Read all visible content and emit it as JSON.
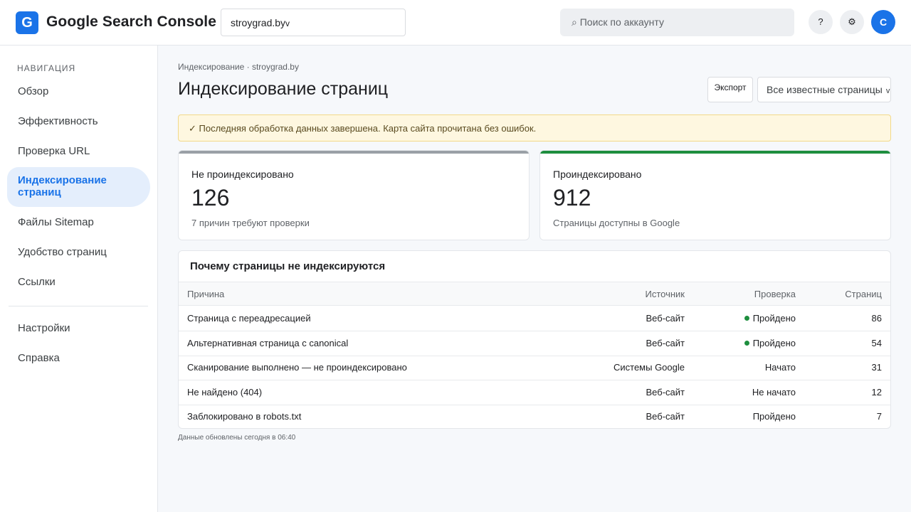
{
  "header": {
    "logo_letter": "G",
    "app_title": "Google Search Console",
    "property": "stroygrad.by",
    "property_chevron": "v",
    "search_placeholder": "⌕ Поиск по аккаунту",
    "help_label": "?",
    "settings_label": "⚙",
    "avatar_letter": "С"
  },
  "sidebar": {
    "section_label": "НАВИГАЦИЯ",
    "items": [
      {
        "label": "Обзор"
      },
      {
        "label": "Эффективность"
      },
      {
        "label": "Проверка URL"
      },
      {
        "label": "Индексирование страниц",
        "active": true
      },
      {
        "label": "Файлы Sitemap"
      },
      {
        "label": "Удобство страниц"
      },
      {
        "label": "Ссылки"
      }
    ],
    "secondary_items": [
      {
        "label": "Настройки"
      },
      {
        "label": "Справка"
      }
    ]
  },
  "main": {
    "breadcrumb": "Индексирование · stroygrad.by",
    "title": "Индексирование страниц",
    "export_label": "Экспорт",
    "filter_label": "Все известные страницы",
    "filter_chevron": "v",
    "banner": "✓ Последняя обработка данных завершена. Карта сайта прочитана без ошибок.",
    "cards": [
      {
        "label": "Не проиндексировано",
        "value": "126",
        "sub": "7 причин требуют проверки",
        "accent": "#9aa0a6"
      },
      {
        "label": "Проиндексировано",
        "value": "912",
        "sub": "Страницы доступны в Google",
        "accent": "#1e8e3e"
      }
    ],
    "table": {
      "title": "Почему страницы не индексируются",
      "columns": [
        "Причина",
        "Источник",
        "Проверка",
        "Страниц"
      ],
      "rows": [
        {
          "reason": "Страница с переадресацией",
          "source": "Веб-сайт",
          "check": "Пройдено",
          "dot": true,
          "count": "86"
        },
        {
          "reason": "Альтернативная страница с canonical",
          "source": "Веб-сайт",
          "check": "Пройдено",
          "dot": true,
          "count": "54"
        },
        {
          "reason": "Сканирование выполнено — не проиндексировано",
          "source": "Системы Google",
          "check": "Начато",
          "dot": false,
          "count": "31"
        },
        {
          "reason": "Не найдено (404)",
          "source": "Веб-сайт",
          "check": "Не начато",
          "dot": false,
          "count": "12"
        },
        {
          "reason": "Заблокировано в robots.txt",
          "source": "Веб-сайт",
          "check": "Пройдено",
          "dot": false,
          "count": "7"
        }
      ]
    },
    "footnote": "Данные обновлены сегодня в 06:40"
  },
  "colors": {
    "accent": "#1a73e8",
    "success": "#1e8e3e",
    "neutral_bar": "#9aa0a6",
    "banner_bg": "#fef7e0"
  }
}
